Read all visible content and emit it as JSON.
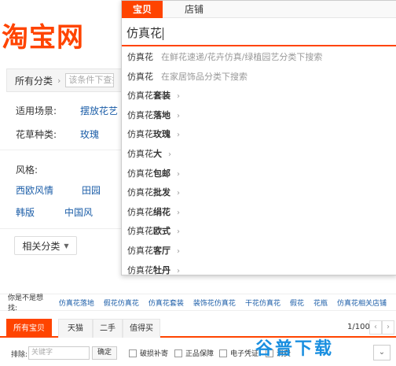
{
  "logo": {
    "text": "淘宝网"
  },
  "filters": {
    "all_categories": "所有分类",
    "search_placeholder": "该条件下查找",
    "scene_label": "适用场景:",
    "scene_value": "摆放花艺",
    "type_label": "花草种类:",
    "type_value": "玫瑰",
    "style_label": "风格:",
    "style_items": [
      "西欧风情",
      "田园",
      "韩版",
      "中国风"
    ],
    "related_button": "相关分类"
  },
  "suggest_strip": {
    "question": "你是不是想找:",
    "items": [
      "仿真花落地",
      "假花仿真花",
      "仿真花套装",
      "装饰花仿真花",
      "干花仿真花",
      "假花",
      "花瓶",
      "仿真花相关店铺"
    ]
  },
  "result_tabs": [
    "所有宝贝",
    "天猫",
    "二手",
    "值得买"
  ],
  "pager": {
    "text": "1/100",
    "prev": "‹",
    "next": "›"
  },
  "bottom_filters": {
    "exclude_label": "排除:",
    "exclude_placeholder": "关键字",
    "confirm_button": "确定",
    "checkboxes": [
      "破损补寄",
      "正品保障",
      "电子凭证",
      "消费"
    ]
  },
  "watermark": {
    "text": "谷普下载"
  },
  "dropdown": {
    "tabs": [
      "宝贝",
      "店铺"
    ],
    "query": "仿真花",
    "suggestions": [
      {
        "base": "仿真花",
        "bold": "",
        "hint": "在鲜花速递/花卉仿真/绿植园艺分类下搜索",
        "chevron": ""
      },
      {
        "base": "仿真花",
        "bold": "",
        "hint": "在家居饰品分类下搜索",
        "chevron": ""
      },
      {
        "base": "仿真花",
        "bold": "套装",
        "hint": "",
        "chevron": "›"
      },
      {
        "base": "仿真花",
        "bold": "落地",
        "hint": "",
        "chevron": "›"
      },
      {
        "base": "仿真花",
        "bold": "玫瑰",
        "hint": "",
        "chevron": "›"
      },
      {
        "base": "仿真花",
        "bold": "大",
        "hint": "",
        "chevron": "›"
      },
      {
        "base": "仿真花",
        "bold": "包邮",
        "hint": "",
        "chevron": "›"
      },
      {
        "base": "仿真花",
        "bold": "批发",
        "hint": "",
        "chevron": "›"
      },
      {
        "base": "仿真花",
        "bold": "绢花",
        "hint": "",
        "chevron": "›"
      },
      {
        "base": "仿真花",
        "bold": "欧式",
        "hint": "",
        "chevron": "›"
      },
      {
        "base": "仿真花",
        "bold": "客厅",
        "hint": "",
        "chevron": "›"
      },
      {
        "base": "仿真花",
        "bold": "牡丹",
        "hint": "",
        "chevron": "›"
      }
    ]
  },
  "colors": {
    "accent": "#ff4400",
    "link": "#1c5ea8",
    "watermark": "#1a8fe0"
  }
}
